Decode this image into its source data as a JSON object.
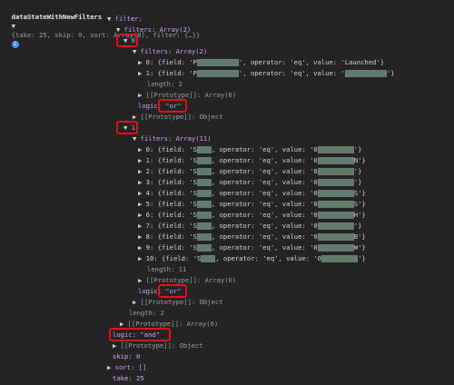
{
  "root": {
    "var": "dataStateWithNewFilters",
    "summary": "{take: 25, skip: 0, sort: Array(0), filter: {…}}",
    "info_icon": "info-icon"
  },
  "lines": {
    "filter_key": "filter:",
    "filters_arr": "filters: Array(2)",
    "g0_index": "0:",
    "g0_filters": "filters: Array(2)",
    "g0_item0": "0: {field: 'P",
    "g0_item0b": "', operator: 'eq', value: 'Launched'}",
    "g0_item1": "1: {field: 'P",
    "g0_item1b": "', operator: 'eq', value: '",
    "g0_item1c": "'}",
    "g0_length": "length: 2",
    "g0_proto_arr": "[[Prototype]]: Array(0)",
    "g0_logic": "logic: \"or\"",
    "g0_proto_obj": "[[Prototype]]: Object",
    "g1_index": "1:",
    "g1_filters": "filters: Array(11)",
    "g1_items": [
      {
        "a": "0: {field: 'S",
        "b": ", operator: 'eq', value: '0",
        "c": "'}"
      },
      {
        "a": "1: {field: 'S",
        "b": ", operator: 'eq', value: '0",
        "c": "N'}"
      },
      {
        "a": "2: {field: 'S",
        "b": ", operator: 'eq', value: '0",
        "c": "'}"
      },
      {
        "a": "3: {field: 'S",
        "b": ", operator: 'eq', value: '0",
        "c": "'}"
      },
      {
        "a": "4: {field: 'S",
        "b": ", operator: 'eq', value: '0",
        "c": "S'}"
      },
      {
        "a": "5: {field: 'S",
        "b": ", operator: 'eq', value: '0",
        "c": "S'}"
      },
      {
        "a": "6: {field: 'S",
        "b": ", operator: 'eq', value: '0",
        "c": "H'}"
      },
      {
        "a": "7: {field: 'S",
        "b": ", operator: 'eq', value: '0",
        "c": "'}"
      },
      {
        "a": "8: {field: 'S",
        "b": ", operator: 'eq', value: '0",
        "c": "B'}"
      },
      {
        "a": "9: {field: 'S",
        "b": ", operator: 'eq', value: '0",
        "c": "W'}"
      },
      {
        "a": "10: {field: 'S",
        "b": ", operator: 'eq', value: '0",
        "c": "'}"
      }
    ],
    "g1_length": "length: 11",
    "g1_proto_arr": "[[Prototype]]: Array(0)",
    "g1_logic": "logic: \"or\"",
    "g1_proto_obj": "[[Prototype]]: Object",
    "filters_length": "length: 2",
    "filters_proto": "[[Prototype]]: Array(0)",
    "filter_logic": "logic: \"and\"",
    "filter_proto": "[[Prototype]]: Object",
    "skip": "skip: 0",
    "sort": "sort: []",
    "take": "take: 25",
    "root_proto": "[[Prototype]]: Object"
  },
  "highlight_color": "#e0121b",
  "redaction_color": "#6f8a7d"
}
